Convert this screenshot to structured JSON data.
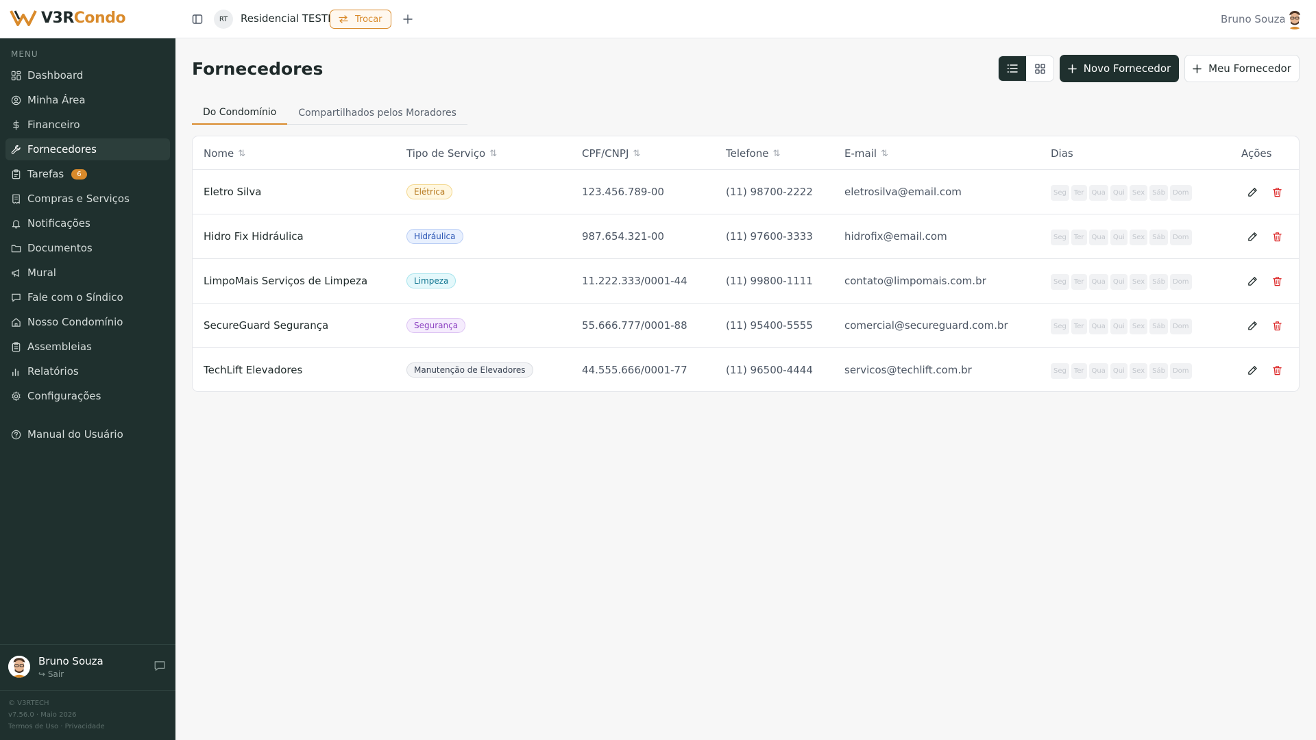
{
  "brand": {
    "logo_part1": "V3R",
    "logo_part2": "Condo"
  },
  "topbar": {
    "condo_initials": "RT",
    "condo_name": "Residencial TESTE",
    "switch_label": "Trocar",
    "user_name": "Bruno Souza"
  },
  "sidebar": {
    "menu_label": "MENU",
    "items": [
      {
        "label": "Dashboard",
        "icon": "dashboard-icon",
        "active": false
      },
      {
        "label": "Minha Área",
        "icon": "user-circle-icon",
        "active": false
      },
      {
        "label": "Financeiro",
        "icon": "dollar-icon",
        "active": false
      },
      {
        "label": "Fornecedores",
        "icon": "wrench-icon",
        "active": true
      },
      {
        "label": "Tarefas",
        "icon": "clipboard-icon",
        "active": false,
        "badge": "6"
      },
      {
        "label": "Compras e Serviços",
        "icon": "receipt-icon",
        "active": false
      },
      {
        "label": "Notificações",
        "icon": "bell-icon",
        "active": false
      },
      {
        "label": "Documentos",
        "icon": "folder-icon",
        "active": false
      },
      {
        "label": "Mural",
        "icon": "megaphone-icon",
        "active": false
      },
      {
        "label": "Fale com o Síndico",
        "icon": "message-icon",
        "active": false
      },
      {
        "label": "Nosso Condomínio",
        "icon": "home-icon",
        "active": false
      },
      {
        "label": "Assembleias",
        "icon": "clipboard-list-icon",
        "active": false
      },
      {
        "label": "Relatórios",
        "icon": "bar-chart-icon",
        "active": false
      },
      {
        "label": "Configurações",
        "icon": "gear-icon",
        "active": false
      }
    ],
    "manual_label": "Manual do Usuário",
    "user_name": "Bruno Souza",
    "logout_label": "Sair",
    "footer_company": "© V3RTECH",
    "footer_version": "v7.56.0 · Maio 2026",
    "footer_terms": "Termos de Uso",
    "footer_sep": "·",
    "footer_privacy": "Privacidade"
  },
  "main": {
    "title": "Fornecedores",
    "new_supplier_label": "Novo Fornecedor",
    "my_supplier_label": "Meu Fornecedor",
    "tabs": [
      {
        "label": "Do Condomínio",
        "active": true
      },
      {
        "label": "Compartilhados pelos Moradores",
        "active": false
      }
    ]
  },
  "table": {
    "headers": {
      "name": "Nome",
      "service": "Tipo de Serviço",
      "doc": "CPF/CNPJ",
      "phone": "Telefone",
      "email": "E-mail",
      "days": "Dias",
      "actions": "Ações"
    },
    "day_labels": [
      "Seg",
      "Ter",
      "Qua",
      "Qui",
      "Sex",
      "Sáb",
      "Dom"
    ],
    "rows": [
      {
        "name": "Eletro Silva",
        "service": "Elétrica",
        "badge_bg": "#fff7e0",
        "badge_fg": "#b7791f",
        "badge_border": "#f3d68a",
        "doc": "123.456.789-00",
        "phone": "(11) 98700-2222",
        "email": "eletrosilva@email.com"
      },
      {
        "name": "Hidro Fix Hidráulica",
        "service": "Hidráulica",
        "badge_bg": "#e8f0fe",
        "badge_fg": "#2b56b5",
        "badge_border": "#b9cdf5",
        "doc": "987.654.321-00",
        "phone": "(11) 97600-3333",
        "email": "hidrofix@email.com"
      },
      {
        "name": "LimpoMais Serviços de Limpeza",
        "service": "Limpeza",
        "badge_bg": "#e4f8fb",
        "badge_fg": "#0e7490",
        "badge_border": "#a5e3ec",
        "doc": "11.222.333/0001-44",
        "phone": "(11) 99800-1111",
        "email": "contato@limpomais.com.br"
      },
      {
        "name": "SecureGuard Segurança",
        "service": "Segurança",
        "badge_bg": "#f5ecfd",
        "badge_fg": "#8b3fc1",
        "badge_border": "#dcc2f3",
        "doc": "55.666.777/0001-88",
        "phone": "(11) 95400-5555",
        "email": "comercial@secureguard.com.br"
      },
      {
        "name": "TechLift Elevadores",
        "service": "Manutenção de Elevadores",
        "badge_bg": "#f3f4f6",
        "badge_fg": "#374151",
        "badge_border": "#d9dce1",
        "doc": "44.555.666/0001-77",
        "phone": "(11) 96500-4444",
        "email": "servicos@techlift.com.br"
      }
    ]
  },
  "colors": {
    "accent": "#d98a2b",
    "sidebar_bg": "#1f302e",
    "danger": "#dc2626"
  }
}
